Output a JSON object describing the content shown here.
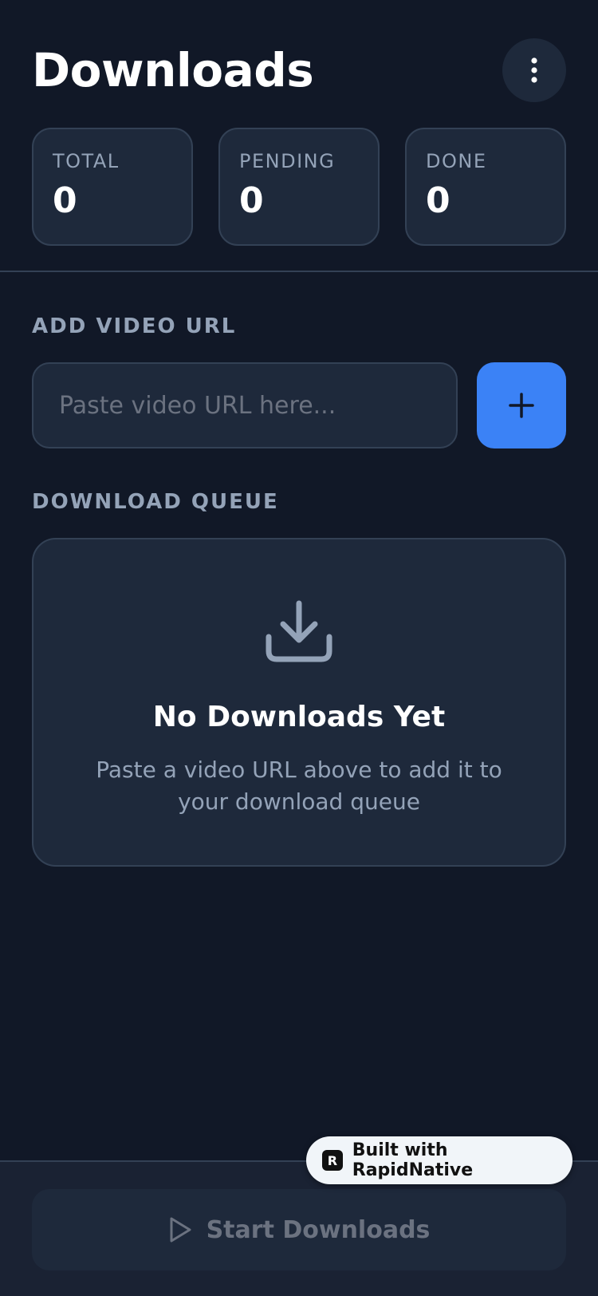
{
  "header": {
    "title": "Downloads",
    "menu_icon": "more-vertical-icon"
  },
  "stats": [
    {
      "label": "TOTAL",
      "value": "0"
    },
    {
      "label": "PENDING",
      "value": "0"
    },
    {
      "label": "DONE",
      "value": "0"
    }
  ],
  "add_section": {
    "label": "ADD VIDEO URL",
    "input_value": "",
    "input_placeholder": "Paste video URL here...",
    "add_icon": "plus-icon"
  },
  "queue": {
    "label": "DOWNLOAD QUEUE",
    "empty_icon": "download-icon",
    "empty_title": "No Downloads Yet",
    "empty_description": "Paste a video URL above to add it to your download queue"
  },
  "footer": {
    "start_label": "Start Downloads",
    "start_icon": "play-icon"
  },
  "badge": {
    "text": "Built with RapidNative",
    "logo_icon": "rapidnative-logo-icon"
  },
  "colors": {
    "background": "#111827",
    "card": "#1e293b",
    "border": "#334155",
    "accent": "#3b82f6",
    "muted_text": "#94a3b8"
  }
}
